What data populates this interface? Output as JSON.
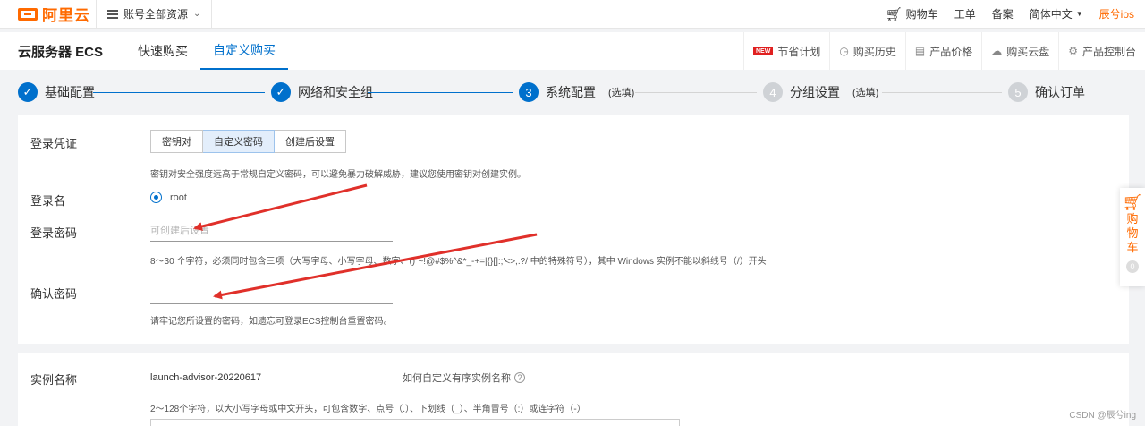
{
  "topbar": {
    "logo": "阿里云",
    "resource_switch": "账号全部资源",
    "cart": "购物车",
    "workorder": "工单",
    "beian": "备案",
    "language": "简体中文",
    "user": "辰兮ios"
  },
  "subbar": {
    "product": "云服务器 ECS",
    "tabs": [
      {
        "label": "快速购买"
      },
      {
        "label": "自定义购买"
      }
    ],
    "new_badge": "NEW",
    "links": {
      "savings": "节省计划",
      "history": "购买历史",
      "price": "产品价格",
      "disk": "购买云盘",
      "console": "产品控制台"
    }
  },
  "steps": [
    {
      "num": "1",
      "label": "基础配置",
      "optional": ""
    },
    {
      "num": "2",
      "label": "网络和安全组",
      "optional": ""
    },
    {
      "num": "3",
      "label": "系统配置",
      "optional": "(选填)"
    },
    {
      "num": "4",
      "label": "分组设置",
      "optional": "(选填)"
    },
    {
      "num": "5",
      "label": "确认订单",
      "optional": ""
    }
  ],
  "form": {
    "credential_label": "登录凭证",
    "credential_options": [
      "密钥对",
      "自定义密码",
      "创建后设置"
    ],
    "credential_hint": "密钥对安全强度远高于常规自定义密码，可以避免暴力破解威胁，建议您使用密钥对创建实例。",
    "login_name_label": "登录名",
    "login_name_value": "root",
    "password_label": "登录密码",
    "password_placeholder": "可创建后设置",
    "password_hint": "8～30 个字符，必须同时包含三项（大写字母、小写字母、数字、()`~!@#$%^&*_-+=|{}[]:;'<>,.?/ 中的特殊符号），其中 Windows 实例不能以斜线号（/）开头",
    "confirm_label": "确认密码",
    "confirm_placeholder": "",
    "confirm_hint": "请牢记您所设置的密码，如遗忘可登录ECS控制台重置密码。",
    "instance_name_label": "实例名称",
    "instance_name_value": "launch-advisor-20220617",
    "instance_help": "如何自定义有序实例名称",
    "instance_hint": "2～128个字符，以大小写字母或中文开头，可包含数字、点号（.）、下划线（_）、半角冒号（:）或连字符（-）"
  },
  "float_cart": {
    "label": "购物车",
    "count": "0"
  },
  "watermark": "CSDN @辰兮ing",
  "colors": {
    "brand": "#ff6a00",
    "primary": "#0070cc",
    "arrow": "#e0302a"
  }
}
